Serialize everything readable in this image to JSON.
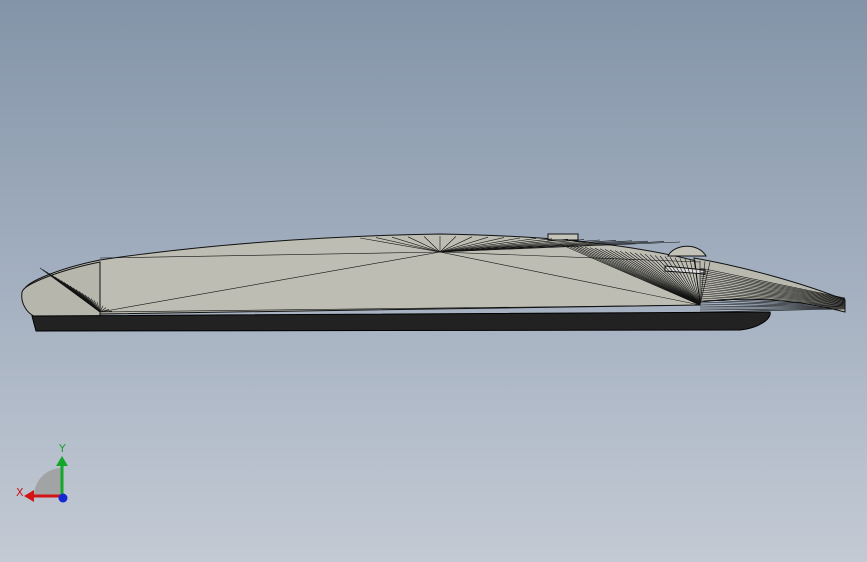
{
  "viewport": {
    "background_top": "#8494a8",
    "background_bottom": "#c3cad4"
  },
  "model": {
    "face_fill": "#bdbdb3",
    "edge_color": "#111111"
  },
  "triad": {
    "x_label": "X",
    "y_label": "Y",
    "x_color": "#d21414",
    "y_color": "#14a82a",
    "z_color": "#1428d2"
  }
}
